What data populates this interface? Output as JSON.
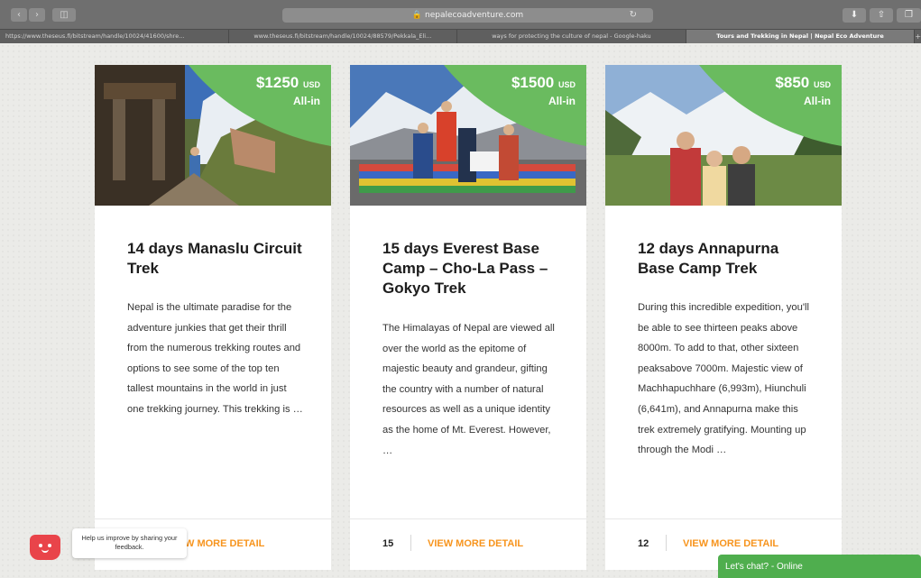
{
  "browser": {
    "url": "nepalecoadventure.com",
    "tabs": [
      "https://www.theseus.fi/bitstream/handle/10024/41600/shre...",
      "www.theseus.fi/bitstream/handle/10024/88579/Pekkala_Eli...",
      "ways for protecting the culture of nepal - Google-haku",
      "Tours and Trekking in Nepal | Nepal Eco Adventure"
    ],
    "active_tab": 3
  },
  "cards": [
    {
      "price": "$1250",
      "price_unit": "USD",
      "price_note": "All-in",
      "title": "14 days Manaslu Circuit Trek",
      "description": "Nepal is the ultimate paradise for the adventure junkies that get their thrill from the numerous trekking routes and options to see some of the top ten tallest mountains in the world in just one trekking journey.  This trekking is …",
      "days": "",
      "more_label": "W MORE DETAIL"
    },
    {
      "price": "$1500",
      "price_unit": "USD",
      "price_note": "All-in",
      "title": "15 days Everest Base Camp – Cho-La Pass – Gokyo Trek",
      "description": "The Himalayas of Nepal are viewed all over the world as the epitome of majestic beauty and grandeur, gifting the country with a number of natural resources as well as a unique identity as the home of Mt. Everest. However, …",
      "days": "15",
      "more_label": "VIEW MORE DETAIL"
    },
    {
      "price": "$850",
      "price_unit": "USD",
      "price_note": "All-in",
      "title": "12 days Annapurna Base Camp Trek",
      "description": "During this incredible expedition, you'll be able to see thirteen peaks above 8000m. To add to that, other sixteen peaksabove 7000m. Majestic view of Machhapuchhare (6,993m), Hiunchuli (6,641m), and Annapurna make this trek extremely gratifying. Mounting up through the Modi …",
      "days": "12",
      "more_label": "VIEW MORE DETAIL"
    }
  ],
  "feedback": {
    "text": "Help us improve by sharing your feedback."
  },
  "chat": {
    "label": "Let's chat? - Online"
  },
  "colors": {
    "badge_green": "#6abb5f",
    "accent_orange": "#f7941d",
    "chat_green": "#4fae4e",
    "feedback_red": "#e9444a"
  }
}
